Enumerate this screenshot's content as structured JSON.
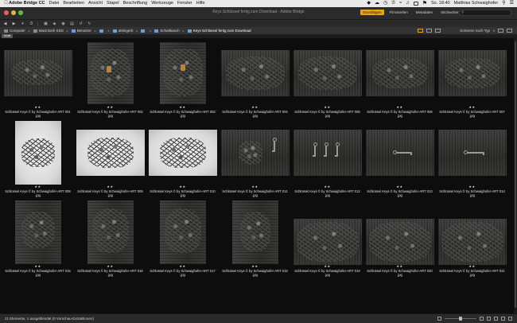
{
  "menubar": {
    "app": "Adobe Bridge CC",
    "items": [
      "Datei",
      "Bearbeiten",
      "Ansicht",
      "Stapel",
      "Beschriftung",
      "Werkzeuge",
      "Fenster",
      "Hilfe"
    ],
    "clock": "So. 18:40",
    "user": "Matthias Schwaighofer"
  },
  "window": {
    "title": "Keys Schlüssel fertig zum Download - Adobe Bridge"
  },
  "workspaces": {
    "tabs": [
      "Grundlagen",
      "Filmstreifen",
      "Metadaten",
      "Stichwörter"
    ],
    "active": "Grundlagen",
    "search_placeholder": ""
  },
  "breadcrumbs": [
    "Computer",
    "Macintosh SSD",
    "Benutzer",
    "",
    "aktingerb",
    "",
    "Schaltkasch",
    "Keys Schlüssel fertig zum Download"
  ],
  "pathbar": {
    "sort_label": "Sortieren nach Typ"
  },
  "content_tab": {
    "label": "Inhalt"
  },
  "thumbnails": [
    {
      "name": "Schlüssel Keys © by Schwaighofer-ART 001",
      "ext": ".jpg",
      "rating": "★★"
    },
    {
      "name": "Schlüssel Keys © by Schwaighofer-ART 002",
      "ext": ".jpg",
      "rating": "★★"
    },
    {
      "name": "Schlüssel Keys © by Schwaighofer-ART 003",
      "ext": ".jpg",
      "rating": "★★"
    },
    {
      "name": "Schlüssel Keys © by Schwaighofer-ART 004",
      "ext": ".jpg",
      "rating": "★★"
    },
    {
      "name": "Schlüssel Keys © by Schwaighofer-ART 005",
      "ext": ".jpg",
      "rating": "★★"
    },
    {
      "name": "Schlüssel Keys © by Schwaighofer-ART 006",
      "ext": ".jpg",
      "rating": "★★"
    },
    {
      "name": "Schlüssel Keys © by Schwaighofer-ART 007",
      "ext": ".jpg",
      "rating": "★★"
    },
    {
      "name": "Schlüssel Keys © by Schwaighofer-ART 008",
      "ext": ".jpg",
      "rating": "★★"
    },
    {
      "name": "Schlüssel Keys © by Schwaighofer-ART 009",
      "ext": ".jpg",
      "rating": "★★"
    },
    {
      "name": "Schlüssel Keys © by Schwaighofer-ART 010",
      "ext": ".jpg",
      "rating": "★★"
    },
    {
      "name": "Schlüssel Keys © by Schwaighofer-ART 011",
      "ext": ".jpg",
      "rating": "★★"
    },
    {
      "name": "Schlüssel Keys © by Schwaighofer-ART 012",
      "ext": ".jpg",
      "rating": "★★"
    },
    {
      "name": "Schlüssel Keys © by Schwaighofer-ART 013",
      "ext": ".jpg",
      "rating": "★★"
    },
    {
      "name": "Schlüssel Keys © by Schwaighofer-ART 014",
      "ext": ".jpg",
      "rating": "★★"
    },
    {
      "name": "Schlüssel Keys © by Schwaighofer-ART 015",
      "ext": ".jpg",
      "rating": "★★"
    },
    {
      "name": "Schlüssel Keys © by Schwaighofer-ART 016",
      "ext": ".jpg",
      "rating": "★★"
    },
    {
      "name": "Schlüssel Keys © by Schwaighofer-ART 017",
      "ext": ".jpg",
      "rating": "★★"
    },
    {
      "name": "Schlüssel Keys © by Schwaighofer-ART 018",
      "ext": ".jpg",
      "rating": "★★"
    },
    {
      "name": "Schlüssel Keys © by Schwaighofer-ART 019",
      "ext": ".jpg",
      "rating": "★★"
    },
    {
      "name": "Schlüssel Keys © by Schwaighofer-ART 020",
      "ext": ".jpg",
      "rating": "★★"
    },
    {
      "name": "Schlüssel Keys © by Schwaighofer-ART 021",
      "ext": ".jpg",
      "rating": "★★"
    }
  ],
  "status": {
    "text": "21 Elemente, 1 ausgeblendet (0 Vorschau-Extraktionen)"
  },
  "colors": {
    "accent": "#e7a21e",
    "background": "#0d0d0d"
  }
}
